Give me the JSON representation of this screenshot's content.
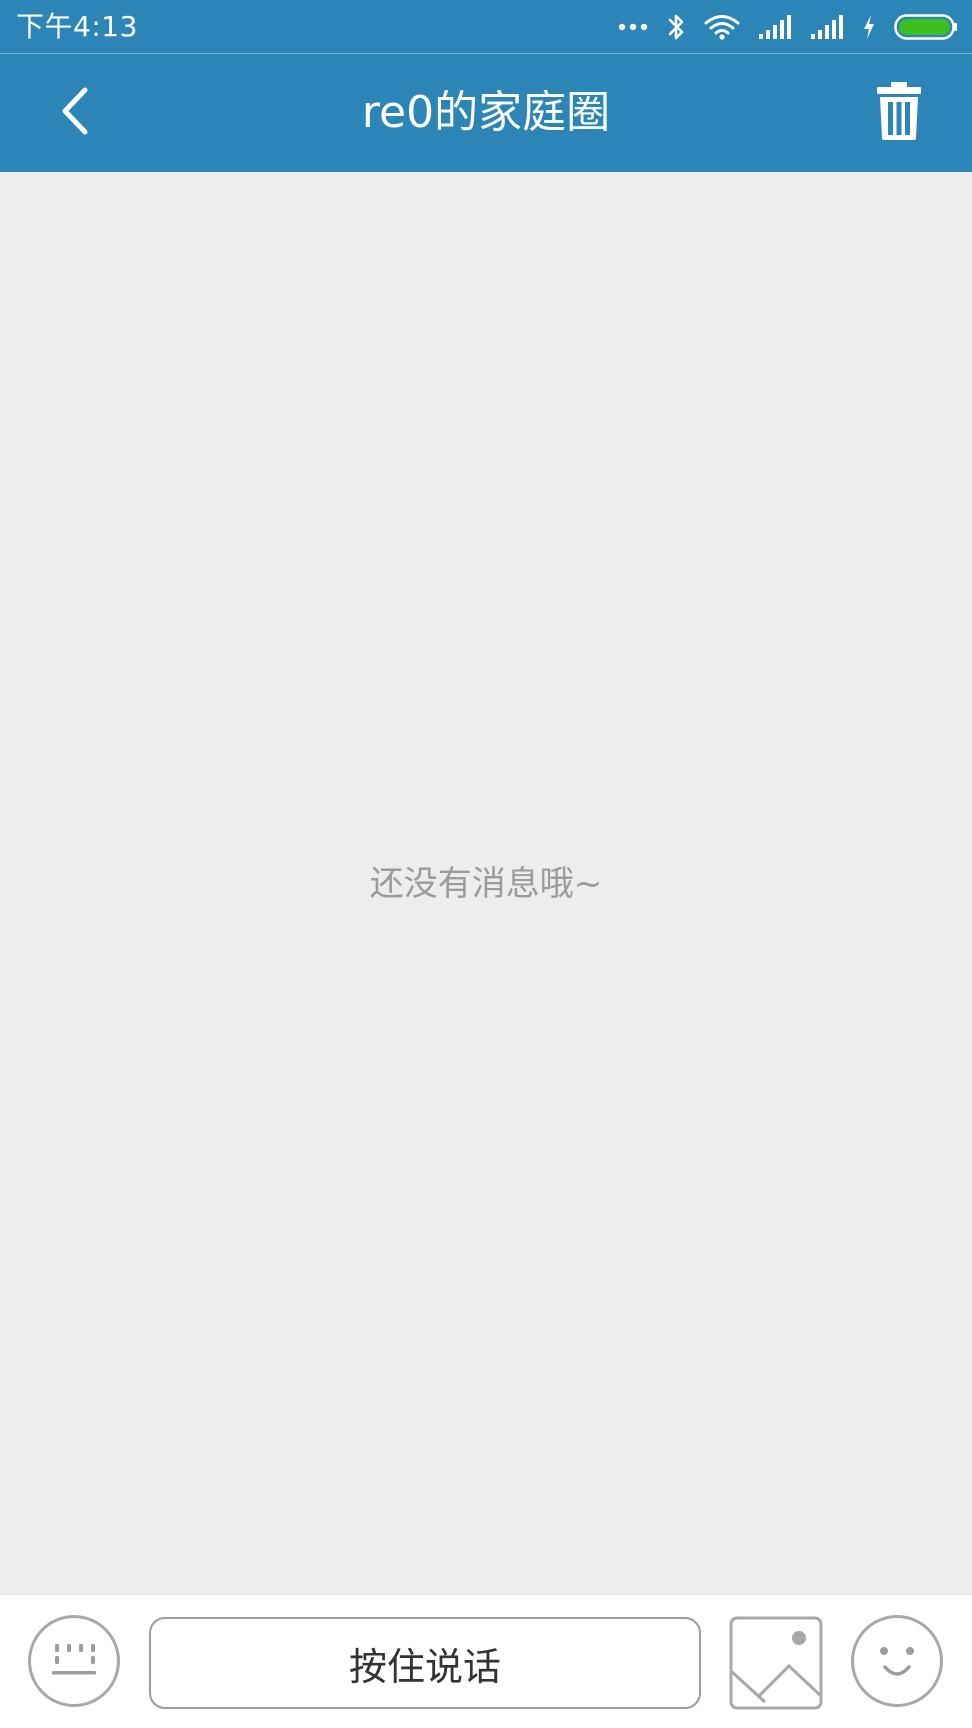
{
  "status_bar": {
    "time": "下午4:13",
    "icons": [
      "more-dots-icon",
      "bluetooth-icon",
      "wifi-icon",
      "signal-icon",
      "signal-icon",
      "charging-icon",
      "battery-icon"
    ],
    "battery_color": "#3dbf20"
  },
  "header": {
    "title": "re0的家庭圈",
    "back_icon": "chevron-left-icon",
    "action_icon": "trash-icon",
    "background_color": "#2b86b7"
  },
  "main": {
    "empty_text": "还没有消息哦~",
    "background_color": "#edecef"
  },
  "input_bar": {
    "hold_to_talk_label": "按住说话",
    "keyboard_icon": "keyboard-icon",
    "image_icon": "image-icon",
    "emoji_icon": "smiley-icon"
  }
}
